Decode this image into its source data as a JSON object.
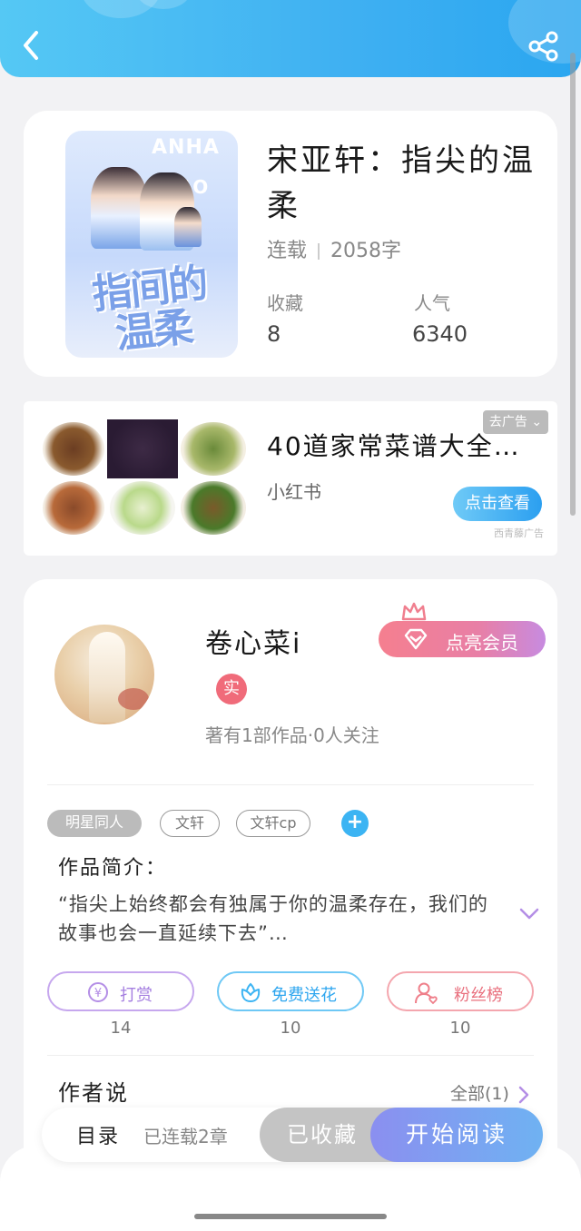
{
  "header": {
    "back_icon": "back-arrow-icon",
    "share_icon": "share-icon",
    "color": "#3fb0f2"
  },
  "book": {
    "cover_title": "指间的温柔",
    "cover_en_1": "ANHA",
    "cover_en_2": "HAO",
    "title": "宋亚轩：指尖的温柔",
    "status": "连载",
    "word_count": "2058字",
    "favorites_label": "收藏",
    "favorites_value": "8",
    "popularity_label": "人气",
    "popularity_value": "6340"
  },
  "ad": {
    "title": "40道家常菜谱大全…",
    "source": "小红书",
    "close_label": "去广告",
    "cta": "点击查看",
    "mark": "西青藤广告"
  },
  "author": {
    "name": "卷心菜i",
    "vip_label": "点亮会员",
    "real_badge": "实",
    "stats": "著有1部作品·0人关注",
    "tags": [
      "明星同人",
      "文轩",
      "文轩cp"
    ],
    "intro_heading": "作品简介：",
    "intro_text": "“指尖上始终都会有独属于你的温柔存在，我们的故事也会一直延续下去”…",
    "actions": [
      {
        "label": "打赏",
        "count": "14",
        "icon": "yuan-icon",
        "color": "#b48ee6"
      },
      {
        "label": "免费送花",
        "count": "10",
        "icon": "flower-icon",
        "color": "#3cb4f3"
      },
      {
        "label": "粉丝榜",
        "count": "10",
        "icon": "fans-icon",
        "color": "#ef7f8a"
      }
    ],
    "author_says": "作者说",
    "all_link": "全部(1)"
  },
  "bottom": {
    "toc": "目录",
    "chapters": "已连载2章",
    "collected": "已收藏",
    "read": "开始阅读"
  }
}
